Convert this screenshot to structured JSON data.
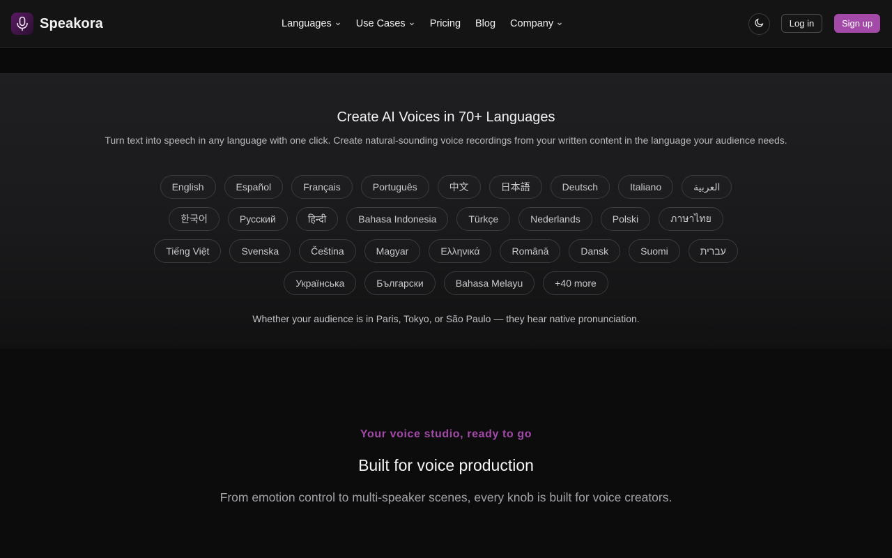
{
  "header": {
    "brand": "Speakora",
    "nav": [
      {
        "label": "Languages",
        "dropdown": true
      },
      {
        "label": "Use Cases",
        "dropdown": true
      },
      {
        "label": "Pricing",
        "dropdown": false
      },
      {
        "label": "Blog",
        "dropdown": false
      },
      {
        "label": "Company",
        "dropdown": true
      }
    ],
    "login_label": "Log in",
    "signup_label": "Sign up",
    "theme_icon": "moon-icon",
    "logo_icon": "microphone-icon"
  },
  "languages": {
    "title": "Create AI Voices in 70+ Languages",
    "subtitle": "Turn text into speech in any language with one click. Create natural-sounding voice recordings from your written content in the language your audience needs.",
    "rows": [
      [
        "English",
        "Español",
        "Français",
        "Português",
        "中文",
        "日本語",
        "Deutsch",
        "Italiano",
        "العربية"
      ],
      [
        "한국어",
        "Русский",
        "हिन्दी",
        "Bahasa Indonesia",
        "Türkçe",
        "Nederlands",
        "Polski",
        "ภาษาไทย"
      ],
      [
        "Tiếng Việt",
        "Svenska",
        "Čeština",
        "Magyar",
        "Ελληνικά",
        "Română",
        "Dansk",
        "Suomi",
        "עברית"
      ],
      [
        "Українська",
        "Български",
        "Bahasa Melayu",
        "+40 more"
      ]
    ],
    "note": "Whether your audience is in Paris, Tokyo, or São Paulo — they hear native pronunciation."
  },
  "production": {
    "eyebrow": "Your voice studio, ready to go",
    "title": "Built for voice production",
    "subtitle": "From emotion control to multi-speaker scenes, every knob is built for voice creators."
  },
  "colors": {
    "accent": "#a34aa8",
    "background": "#0c0c0d"
  }
}
